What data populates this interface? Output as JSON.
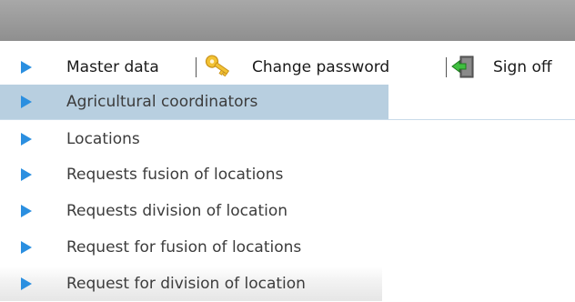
{
  "menu": {
    "master_data": "Master data",
    "change_password": "Change password",
    "sign_off": "Sign off"
  },
  "submenu": {
    "items": [
      {
        "label": "Agricultural coordinators"
      },
      {
        "label": "Locations"
      },
      {
        "label": "Requests fusion of locations"
      },
      {
        "label": "Requests division of location"
      },
      {
        "label": "Request for fusion of locations"
      },
      {
        "label": "Request for division of location"
      }
    ]
  },
  "colors": {
    "arrow": "#2b8fe0",
    "active_bg": "#b8cfe0",
    "header_bar": "#9c9c9c"
  },
  "icons": {
    "change_password": "key-icon",
    "sign_off": "exit-door-icon"
  }
}
